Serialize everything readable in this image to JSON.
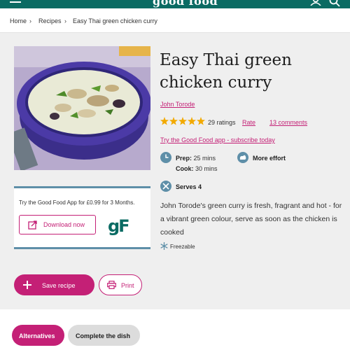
{
  "header": {
    "logo": "good food"
  },
  "breadcrumb": {
    "items": [
      "Home",
      "Recipes",
      "Easy Thai green chicken curry"
    ],
    "separator": "›"
  },
  "recipe": {
    "title": "Easy Thai green chicken curry",
    "author": "John Torode",
    "rating_stars": 5,
    "ratings_text": "29 ratings",
    "rate_label": "Rate",
    "comments_label": "13 comments",
    "app_link": "Try the Good Food app - subscribe today",
    "prep_label": "Prep:",
    "prep_value": "25 mins",
    "cook_label": "Cook:",
    "cook_value": "30 mins",
    "effort": "More effort",
    "serves": "Serves 4",
    "description": "John Torode's green curry is fresh, fragrant and hot - for a vibrant green colour, serve as soon as the chicken is cooked",
    "freezable": "Freezable"
  },
  "promo": {
    "text": "Try the Good Food App for £0.99 for 3 Months.",
    "download_label": "Download now",
    "logo_text": "gF"
  },
  "actions": {
    "save_label": "Save recipe",
    "print_label": "Print"
  },
  "tabs": [
    {
      "label": "Alternatives",
      "active": true
    },
    {
      "label": "Complete the dish",
      "active": false
    }
  ],
  "colors": {
    "brand": "#0a6b63",
    "accent": "#c42076",
    "icon_blue": "#5e8fa8",
    "star": "#f2a900"
  }
}
